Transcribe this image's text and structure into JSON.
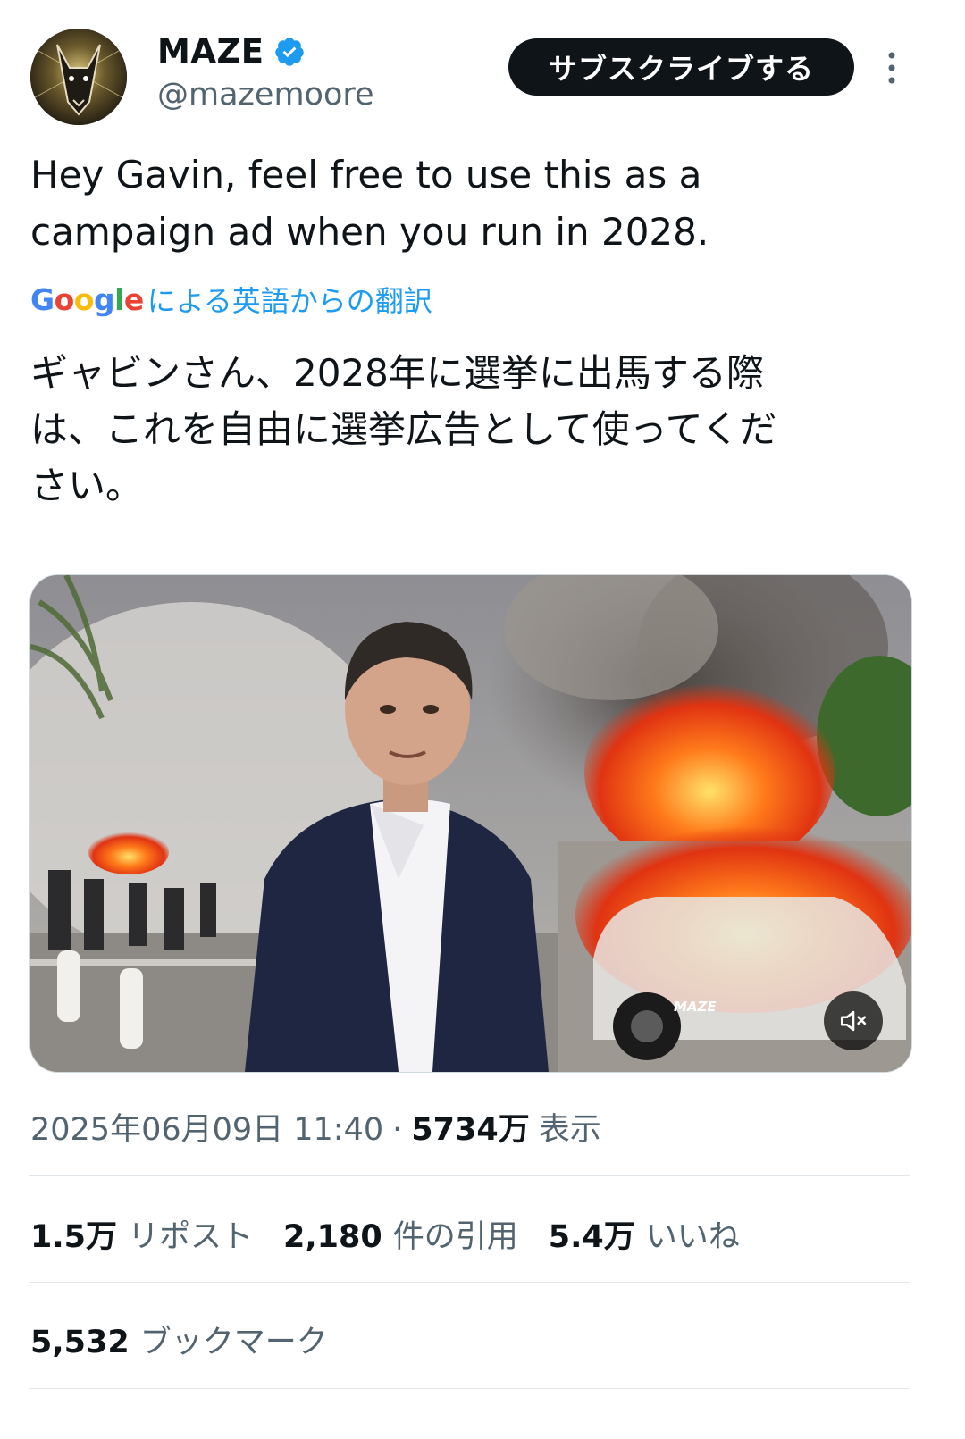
{
  "author": {
    "display_name": "MAZE",
    "handle": "@mazemoore",
    "verified": true
  },
  "subscribe_label": "サブスクライブする",
  "tweet": {
    "text_line1": "Hey Gavin, feel free to use this as a",
    "text_line2": "campaign ad when you run in 2028.",
    "translate_google": "Google",
    "translate_label": "による英語からの翻訳",
    "translated_line1": "ギャビンさん、2028年に選挙に出馬する際",
    "translated_line2": "は、これを自由に選挙広告として使ってくだ",
    "translated_line3": "さい。"
  },
  "media": {
    "watermark": "MAZE",
    "mute_icon": "speaker-muted-icon"
  },
  "meta": {
    "timestamp": "2025年06月09日 11:40",
    "separator": "·",
    "views_count": "5734万",
    "views_label": "表示"
  },
  "stats": {
    "reposts_count": "1.5万",
    "reposts_label": "リポスト",
    "quotes_count": "2,180",
    "quotes_label": "件の引用",
    "likes_count": "5.4万",
    "likes_label": "いいね",
    "bookmarks_count": "5,532",
    "bookmarks_label": "ブックマーク"
  },
  "colors": {
    "link_blue": "#1d9bf0",
    "verified_blue": "#1d9bf0",
    "text_primary": "#0f1419",
    "text_secondary": "#536471"
  }
}
